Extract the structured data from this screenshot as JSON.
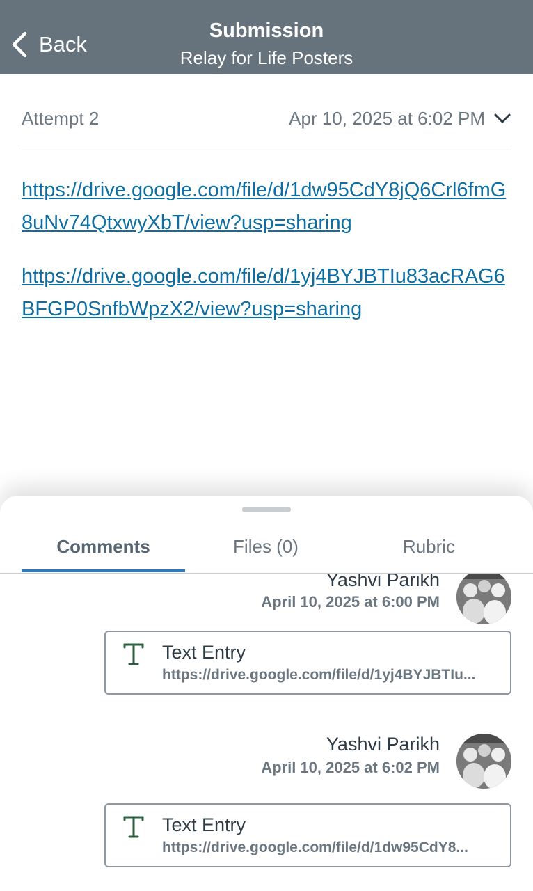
{
  "header": {
    "back_label": "Back",
    "title": "Submission",
    "subtitle": "Relay for Life Posters",
    "bg_color": "#66727c"
  },
  "attempt": {
    "label": "Attempt 2",
    "date": "Apr 10, 2025 at 6:02 PM",
    "dropdown_icon": "chevron-down-icon"
  },
  "links": [
    "https://drive.google.com/file/d/1dw95CdY8jQ6Crl6fmG8uNv74QtxwyXbT/view?usp=sharing",
    "https://drive.google.com/file/d/1yj4BYJBTIu83acRAG6BFGP0SnfbWpzX2/view?usp=sharing"
  ],
  "tabs": [
    {
      "label": "Comments",
      "active": true
    },
    {
      "label": "Files (0)",
      "active": false
    },
    {
      "label": "Rubric",
      "active": false
    }
  ],
  "comments": [
    {
      "author": "Yashvi Parikh",
      "time": "April 10, 2025 at 6:00 PM",
      "entry_title": "Text Entry",
      "entry_url": "https://drive.google.com/file/d/1yj4BYJBTIu..."
    },
    {
      "author": "Yashvi Parikh",
      "time": "April 10, 2025 at 6:02 PM",
      "entry_title": "Text Entry",
      "entry_url": "https://drive.google.com/file/d/1dw95CdY8..."
    }
  ],
  "colors": {
    "link": "#0d6ea3",
    "tab_underline": "#2b7abc",
    "text_entry_icon": "#2c5f3f"
  }
}
